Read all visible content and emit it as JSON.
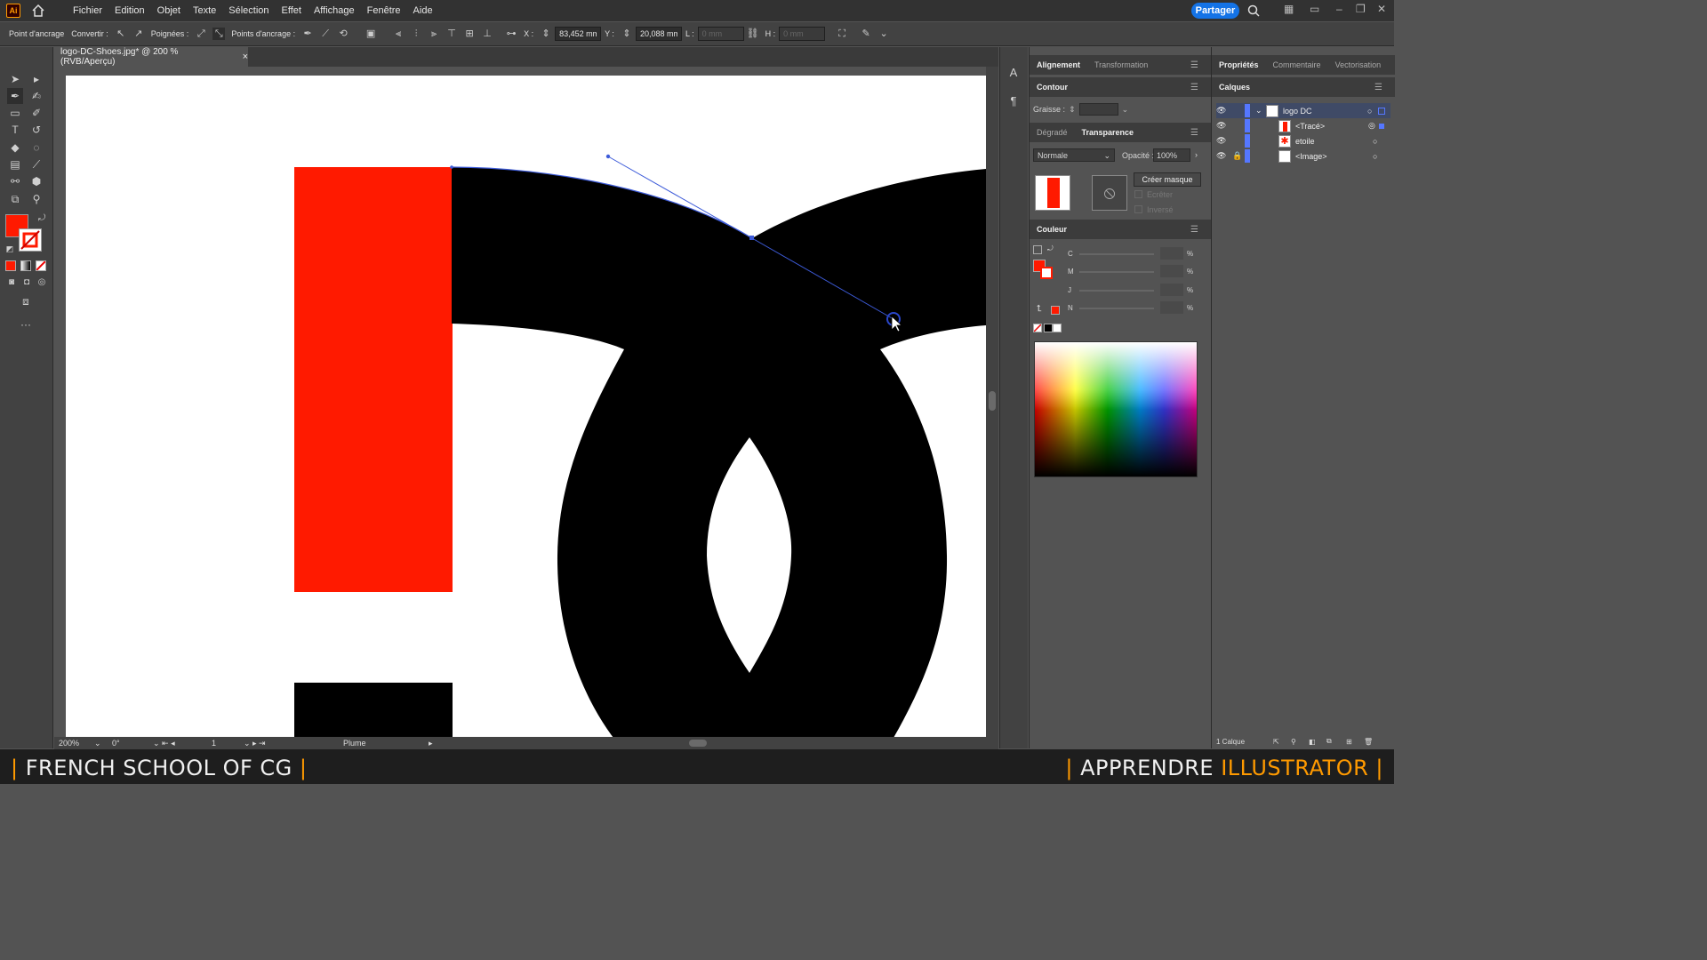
{
  "app": {
    "logo": "Ai",
    "menus": [
      "Fichier",
      "Edition",
      "Objet",
      "Texte",
      "Sélection",
      "Effet",
      "Affichage",
      "Fenêtre",
      "Aide"
    ],
    "share_label": "Partager"
  },
  "controlbar": {
    "anchor_label": "Point d'ancrage",
    "convert_label": "Convertir :",
    "handles_label": "Poignées :",
    "anchors_label": "Points d'ancrage :",
    "x_label": "X :",
    "x_value": "83,452 mm",
    "y_label": "Y :",
    "y_value": "20,088 mm",
    "l_label": "L :",
    "l_value": "0 mm",
    "h_label": "H :",
    "h_value": "0 mm"
  },
  "document": {
    "tab_title": "logo-DC-Shoes.jpg* @ 200 % (RVB/Aperçu)",
    "close": "×"
  },
  "status": {
    "zoom": "200%",
    "rotation": "0°",
    "artboard_num": "1",
    "tool_name": "Plume"
  },
  "panels": {
    "align_tab": "Alignement",
    "transform_tab": "Transformation",
    "contour_tab": "Contour",
    "weight_label": "Graisse :",
    "gradient_tab": "Dégradé",
    "transparency_tab": "Transparence",
    "blend_mode": "Normale",
    "opacity_label": "Opacité :",
    "opacity_value": "100%",
    "make_mask": "Créer masque",
    "clip_label": "Ecrêter",
    "invert_label": "Inversé",
    "color_tab": "Couleur",
    "channels": [
      "C",
      "M",
      "J",
      "N"
    ],
    "percent": "%"
  },
  "right": {
    "tabs": [
      "Propriétés",
      "Commentaire",
      "Vectorisation"
    ],
    "layers_tab": "Calques",
    "layers": [
      {
        "name": "logo DC",
        "locked": false
      },
      {
        "name": "<Tracé>",
        "locked": false
      },
      {
        "name": "etoile",
        "locked": false
      },
      {
        "name": "<Image>",
        "locked": true
      }
    ],
    "layer_count": "1 Calque"
  },
  "banner": {
    "left": "FRENCH SCHOOL OF CG",
    "right_a": "APPRENDRE",
    "right_b": "ILLUSTRATOR",
    "bar": "|"
  },
  "colors": {
    "red": "#ff1a00",
    "black": "#000000",
    "path_blue": "#3d5bd9",
    "accent_orange": "#ff9a00",
    "share_blue": "#1473e6"
  }
}
